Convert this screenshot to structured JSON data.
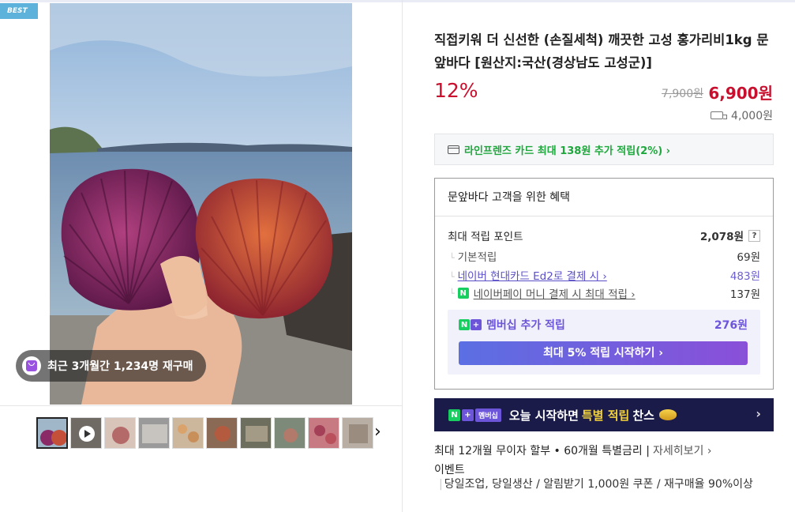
{
  "badge": "BEST",
  "repurchase_text": "최근 3개월간 1,234명 재구매",
  "product": {
    "title": "직접키워 더 신선한 (손질세척) 깨끗한 고성 홍가리비1kg 문앞바다 [원산지:국산(경상남도 고성군)]",
    "discount": "12%",
    "original_price": "7,900원",
    "sale_price": "6,900원",
    "shipping_fee": "4,000원"
  },
  "card_promo": "라인프렌즈 카드 최대 138원 추가 적립(2%) ›",
  "benefit": {
    "heading": "문앞바다 고객을 위한 혜택",
    "max_points_label": "최대 적립 포인트",
    "max_points_value": "2,078원",
    "help": "?",
    "basic_label": "기본적립",
    "basic_value": "69원",
    "card_label": "네이버 현대카드 Ed2로 결제 시 ›",
    "card_value": "483원",
    "npay_label": "네이버페이 머니 결제 시 최대 적립 ›",
    "npay_value": "137원",
    "membership_label": "멤버십 추가 적립",
    "membership_value": "276원",
    "membership_button": "최대 5% 적립 시작하기 ›"
  },
  "banner": {
    "pill": "멤버십",
    "text_before": "오늘 시작하면",
    "text_highlight": "특별 적립",
    "text_after": "찬스",
    "arrow": "›"
  },
  "installment": {
    "text": "최대 12개월 무이자 할부 • 60개월 특별금리 |",
    "more": "자세히보기 ›"
  },
  "event": {
    "label": "이벤트",
    "text": "당일조업, 당일생산 / 알림받기 1,000원 쿠폰 / 재구매율 90%이상"
  },
  "thumbnail_next": "›",
  "colors": {
    "accent_red": "#c8102e",
    "naver_green": "#19ce60",
    "membership_purple": "#6c55d9",
    "banner_navy": "#1b1b4a"
  }
}
